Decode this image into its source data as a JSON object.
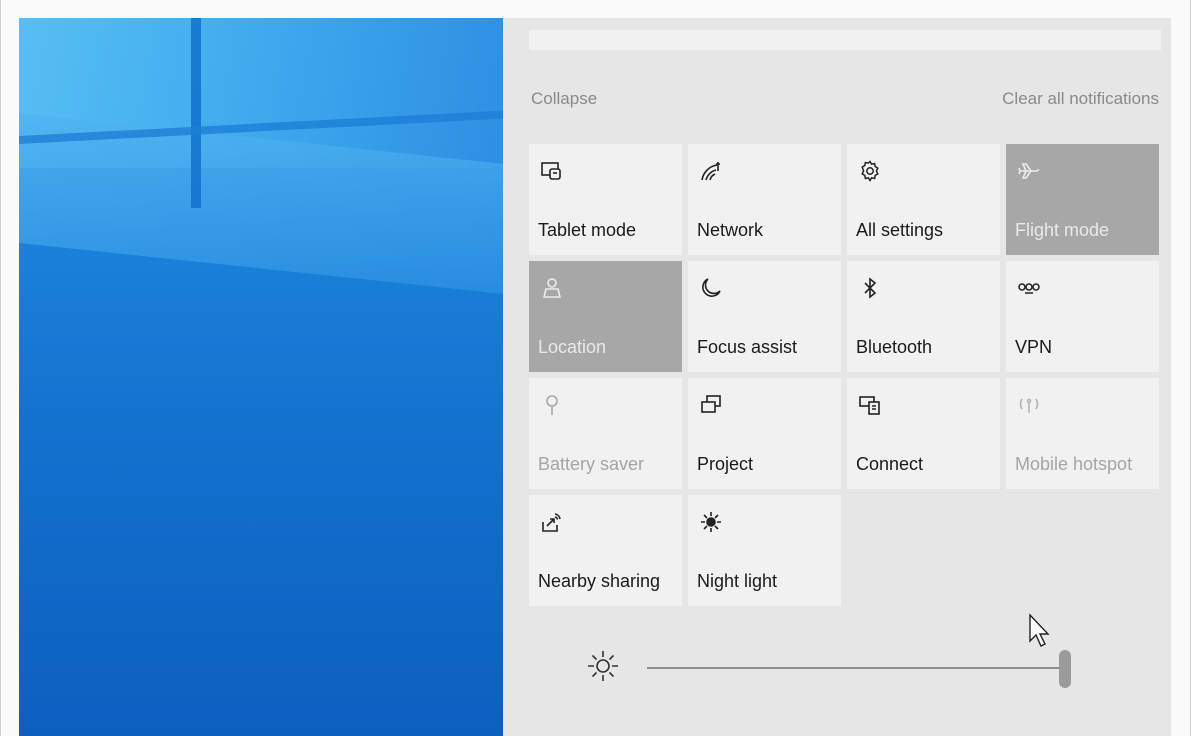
{
  "panel": {
    "collapse_label": "Collapse",
    "clear_label": "Clear all notifications"
  },
  "tiles": [
    {
      "label": "Tablet mode",
      "icon": "tablet-mode-icon",
      "state": "off"
    },
    {
      "label": "Network",
      "icon": "network-icon",
      "state": "off"
    },
    {
      "label": "All settings",
      "icon": "gear-icon",
      "state": "off"
    },
    {
      "label": "Flight mode",
      "icon": "airplane-icon",
      "state": "on"
    },
    {
      "label": "Location",
      "icon": "location-icon",
      "state": "on"
    },
    {
      "label": "Focus assist",
      "icon": "moon-icon",
      "state": "off"
    },
    {
      "label": "Bluetooth",
      "icon": "bluetooth-icon",
      "state": "off"
    },
    {
      "label": "VPN",
      "icon": "vpn-icon",
      "state": "off"
    },
    {
      "label": "Battery saver",
      "icon": "battery-saver-icon",
      "state": "disabled"
    },
    {
      "label": "Project",
      "icon": "project-icon",
      "state": "off"
    },
    {
      "label": "Connect",
      "icon": "connect-icon",
      "state": "off"
    },
    {
      "label": "Mobile hotspot",
      "icon": "hotspot-icon",
      "state": "disabled"
    },
    {
      "label": "Nearby sharing",
      "icon": "nearby-sharing-icon",
      "state": "off"
    },
    {
      "label": "Night light",
      "icon": "night-light-icon",
      "state": "off"
    }
  ],
  "brightness": {
    "icon": "brightness-icon",
    "level": 1.0
  },
  "colors": {
    "panel_bg": "#e6e6e6",
    "tile_bg": "#f1f1f1",
    "tile_on": "#a7a7a7",
    "wallpaper": "#1677d3"
  }
}
